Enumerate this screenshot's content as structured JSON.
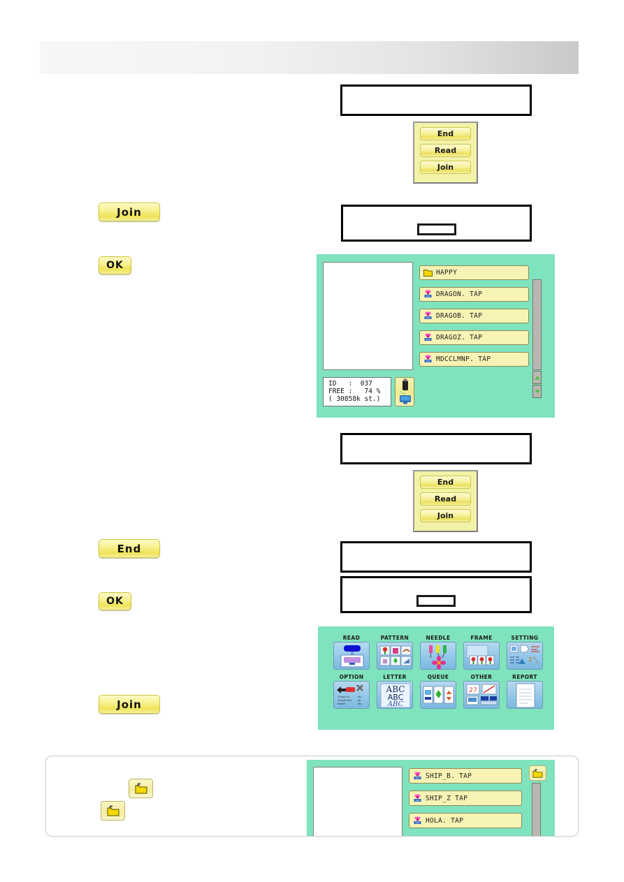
{
  "header": {
    "title": ""
  },
  "dialogs": {
    "d1": {
      "text": "",
      "has_inner_button": false
    },
    "d2": {
      "text": "",
      "has_inner_button": true
    },
    "d3": {
      "text": "",
      "has_inner_button": false
    },
    "d4": {
      "text": "",
      "has_inner_button": false
    },
    "d5": {
      "text": "",
      "has_inner_button": true
    }
  },
  "button_stacks": {
    "stack1": {
      "buttons": [
        "End",
        "Read",
        "Join"
      ]
    },
    "stack2": {
      "buttons": [
        "End",
        "Read",
        "Join"
      ]
    }
  },
  "left_buttons": [
    {
      "label": "Join",
      "name": "join-button-1"
    },
    {
      "label": "OK",
      "name": "ok-button-1"
    },
    {
      "label": "End",
      "name": "end-button-1"
    },
    {
      "label": "OK",
      "name": "ok-button-2"
    },
    {
      "label": "Join",
      "name": "join-button-2"
    }
  ],
  "file_browser": {
    "files": [
      {
        "label": "HAPPY",
        "icon": "folder-icon"
      },
      {
        "label": "DRAGON. TAP",
        "icon": "tap-pattern-icon"
      },
      {
        "label": "DRAGOB. TAP",
        "icon": "tap-pattern-icon"
      },
      {
        "label": "DRAGOZ. TAP",
        "icon": "tap-pattern-icon"
      },
      {
        "label": "MDCCLMNP. TAP",
        "icon": "tap-pattern-icon"
      }
    ],
    "info": {
      "id_label": "ID",
      "id_value": "037",
      "free_label": "FREE",
      "free_value": "74 %",
      "capacity": "( 30858k st.)",
      "text": "ID   :  037\nFREE :   74 %\n( 30858k st.)"
    },
    "device_icon": "usb-to-machine-icon",
    "scroll_up": "scroll-up-arrow",
    "scroll_down": "scroll-down-arrow"
  },
  "main_menu": {
    "items": [
      {
        "label": "READ",
        "icon": "read-icon"
      },
      {
        "label": "PATTERN",
        "icon": "pattern-icon"
      },
      {
        "label": "NEEDLE",
        "icon": "needle-icon"
      },
      {
        "label": "FRAME",
        "icon": "frame-icon"
      },
      {
        "label": "SETTING",
        "icon": "setting-icon"
      },
      {
        "label": "OPTION",
        "icon": "option-icon"
      },
      {
        "label": "LETTER",
        "icon": "letter-icon"
      },
      {
        "label": "QUEUE",
        "icon": "queue-icon"
      },
      {
        "label": "OTHER",
        "icon": "other-icon"
      },
      {
        "label": "REPORT",
        "icon": "report-icon"
      }
    ]
  },
  "note_panel": {
    "folder_up_buttons": [
      {
        "name": "folder-up-button-1",
        "icon": "folder-up-icon"
      },
      {
        "name": "folder-up-button-2",
        "icon": "folder-up-icon"
      }
    ],
    "files": [
      {
        "label": "SHIP_B. TAP",
        "icon": "tap-pattern-icon"
      },
      {
        "label": "SHIP_Z  TAP",
        "icon": "tap-pattern-icon"
      },
      {
        "label": "HOLA. TAP",
        "icon": "tap-pattern-icon"
      }
    ],
    "folder_button": "folder-up-icon"
  },
  "colors": {
    "screen_green": "#7fe3be",
    "button_yellow": "#f2f2a8",
    "file_row": "#f7f3b4",
    "menu_icon_blue": "#93c7e8"
  }
}
